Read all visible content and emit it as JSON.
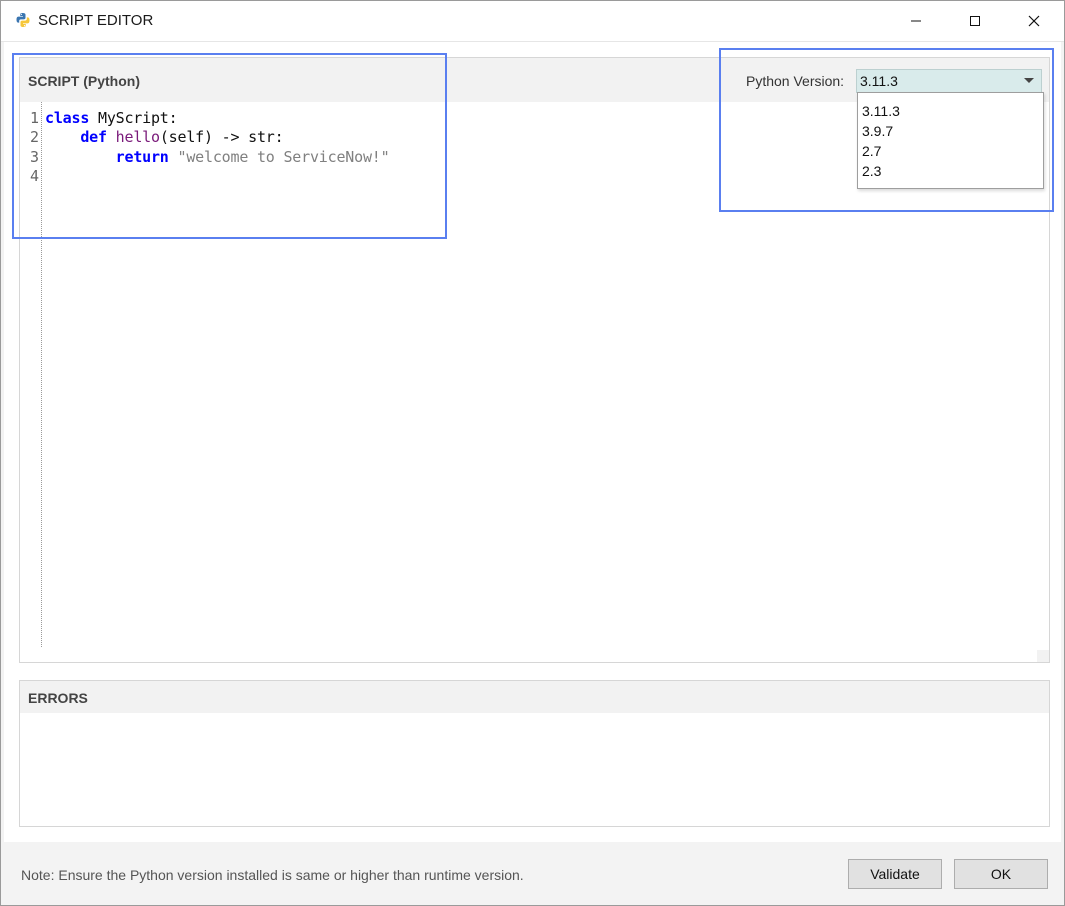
{
  "window": {
    "title": "SCRIPT EDITOR",
    "icon": "python-icon",
    "controls": [
      "minimize-icon",
      "maximize-icon",
      "close-icon"
    ]
  },
  "script_panel": {
    "title": "SCRIPT (Python)",
    "version_label": "Python Version:",
    "selected_version": "3.11.3",
    "version_options": [
      "3.11.3",
      "3.9.7",
      "2.7",
      "2.3"
    ]
  },
  "editor": {
    "line_numbers": [
      "1",
      "2",
      "3",
      "4"
    ],
    "lines": [
      [
        {
          "t": "kw",
          "v": "class"
        },
        {
          "t": "plain",
          "v": " MyScript:"
        }
      ],
      [
        {
          "t": "plain",
          "v": "    "
        },
        {
          "t": "kw",
          "v": "def"
        },
        {
          "t": "plain",
          "v": " "
        },
        {
          "t": "fn",
          "v": "hello"
        },
        {
          "t": "plain",
          "v": "(self) -> str:"
        }
      ],
      [
        {
          "t": "plain",
          "v": "        "
        },
        {
          "t": "kw",
          "v": "return"
        },
        {
          "t": "plain",
          "v": " "
        },
        {
          "t": "str",
          "v": "\"welcome to ServiceNow!\""
        }
      ],
      []
    ]
  },
  "errors_panel": {
    "title": "ERRORS"
  },
  "footer": {
    "note": "Note: Ensure the Python version installed is same or higher than runtime version.",
    "validate_label": "Validate",
    "ok_label": "OK"
  },
  "colors": {
    "keyword": "#0000ff",
    "function_name": "#7a1a7a",
    "string": "#808080",
    "highlight_box": "#5a7ff0",
    "select_bg": "#d9ebeb"
  }
}
